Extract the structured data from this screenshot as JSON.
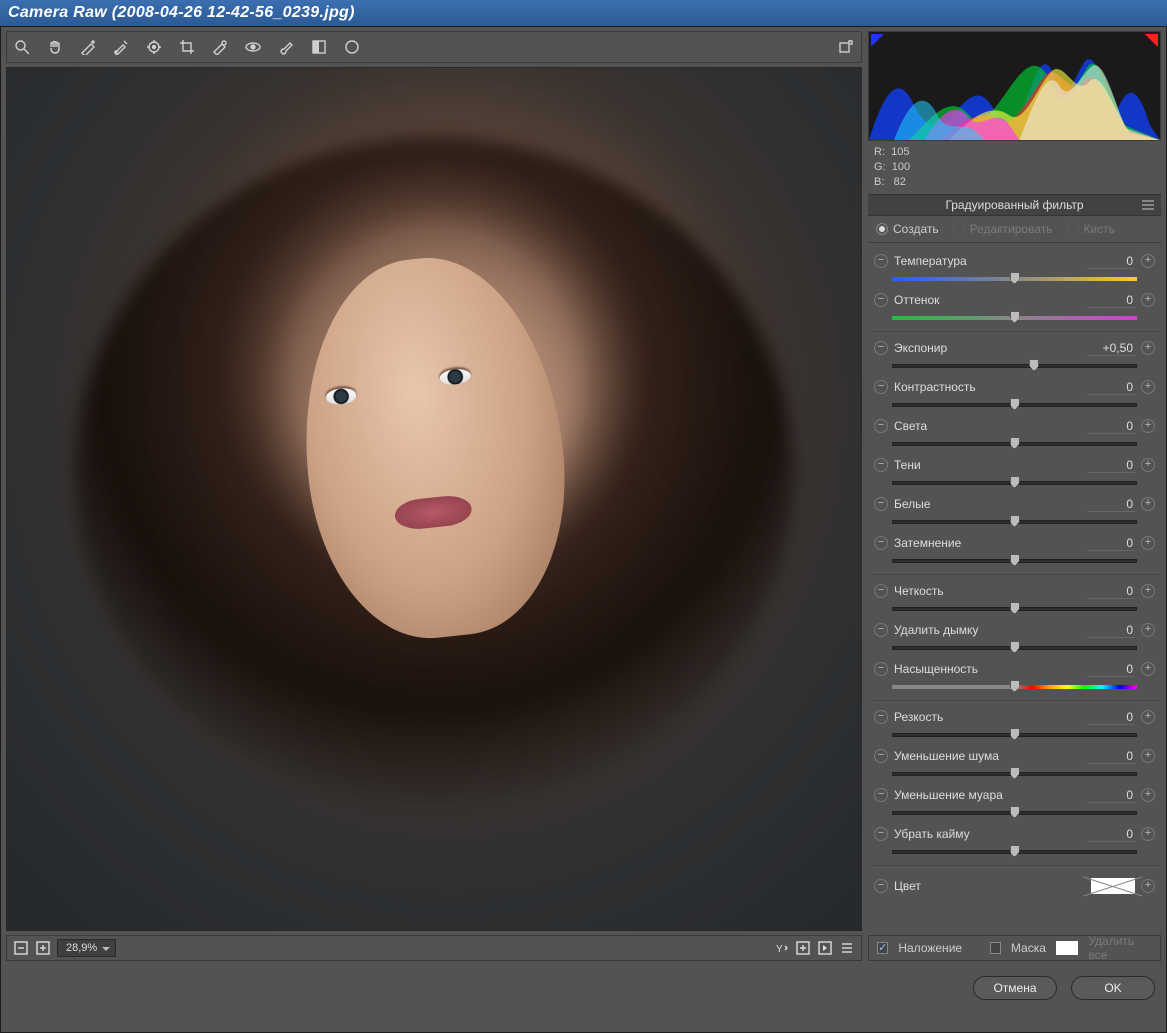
{
  "window": {
    "title": "Camera Raw (2008-04-26 12-42-56_0239.jpg)"
  },
  "toolbar": {
    "tools": [
      "zoom",
      "hand",
      "white-balance",
      "color-sampler",
      "target-adjust",
      "crop",
      "spot-heal",
      "red-eye",
      "brush",
      "grad-filter",
      "rotate"
    ],
    "presets_icon": "presets"
  },
  "status": {
    "zoom": "28,9%"
  },
  "readout": {
    "r_label": "R:",
    "r": "105",
    "g_label": "G:",
    "g": "100",
    "b_label": "B:",
    "b": "82"
  },
  "panel": {
    "title": "Градуированный фильтр",
    "modes": {
      "create": "Создать",
      "edit": "Редактировать",
      "brush": "Кисть"
    }
  },
  "groups": [
    {
      "items": [
        {
          "key": "temperature",
          "label": "Температура",
          "value": "0",
          "pos": 50,
          "gradient": "linear-gradient(90deg,#2060ff,#888 50%,#ffcc20)"
        },
        {
          "key": "tint",
          "label": "Оттенок",
          "value": "0",
          "pos": 50,
          "gradient": "linear-gradient(90deg,#20c040,#888 50%,#d040d0)"
        }
      ]
    },
    {
      "items": [
        {
          "key": "exposure",
          "label": "Экспонир",
          "value": "+0,50",
          "pos": 58
        },
        {
          "key": "contrast",
          "label": "Контрастность",
          "value": "0",
          "pos": 50
        },
        {
          "key": "highlights",
          "label": "Света",
          "value": "0",
          "pos": 50
        },
        {
          "key": "shadows",
          "label": "Тени",
          "value": "0",
          "pos": 50
        },
        {
          "key": "whites",
          "label": "Белые",
          "value": "0",
          "pos": 50
        },
        {
          "key": "blacks",
          "label": "Затемнение",
          "value": "0",
          "pos": 50
        }
      ]
    },
    {
      "items": [
        {
          "key": "clarity",
          "label": "Четкость",
          "value": "0",
          "pos": 50
        },
        {
          "key": "dehaze",
          "label": "Удалить дымку",
          "value": "0",
          "pos": 50
        },
        {
          "key": "saturation",
          "label": "Насыщенность",
          "value": "0",
          "pos": 50,
          "gradient": "linear-gradient(90deg,#888 0%,#888 50%,red,orange,yellow,lime,cyan,blue,magenta)"
        }
      ]
    },
    {
      "items": [
        {
          "key": "sharpness",
          "label": "Резкость",
          "value": "0",
          "pos": 50
        },
        {
          "key": "noise",
          "label": "Уменьшение шума",
          "value": "0",
          "pos": 50
        },
        {
          "key": "moire",
          "label": "Уменьшение муара",
          "value": "0",
          "pos": 50
        },
        {
          "key": "defringe",
          "label": "Убрать кайму",
          "value": "0",
          "pos": 50
        }
      ]
    }
  ],
  "colorRow": {
    "label": "Цвет"
  },
  "options": {
    "overlay": "Наложение",
    "mask": "Маска",
    "clear": "Удалить все"
  },
  "buttons": {
    "cancel": "Отмена",
    "ok": "OK"
  }
}
